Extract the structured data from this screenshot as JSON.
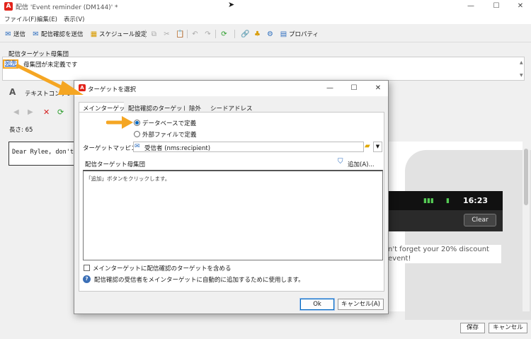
{
  "window": {
    "title": "配信 'Event reminder (DM144)' *",
    "minimize_glyph": "—",
    "maximize_glyph": "☐",
    "close_glyph": "✕"
  },
  "menu": [
    "ファイル(F)",
    "編集(E)",
    "表示(V)"
  ],
  "toolbar": {
    "send": "送信",
    "send_proof": "配信確認を送信",
    "schedule": "スケジュール設定",
    "properties": "プロパティ"
  },
  "main": {
    "target_group_label": "配信ターゲット母集団",
    "to_link": "宛先",
    "undefined_text": "母集団が未定義です",
    "text_content_tab": "テキストコンテンツ",
    "length_label": "長さ: 65",
    "editor_text": "Dear Rylee, don't",
    "save": "保存",
    "cancel": "キャンセル"
  },
  "phone": {
    "time": "16:23",
    "clear": "Clear",
    "sms_text": "n't forget your 20% discount\nevent!"
  },
  "dialog": {
    "title": "ターゲットを選択",
    "tabs": [
      "メインターゲット",
      "配信確認のターゲット",
      "除外",
      "シードアドレス"
    ],
    "radio_db": "データベースで定義",
    "radio_ext": "外部ファイルで定義",
    "mapping_label": "ターゲットマッピング:",
    "mapping_value": "受信者 (nms:recipient)",
    "group_label": "配信ターゲット母集団",
    "add_button": "追加(A)...",
    "group_hint": "「追加」ボタンをクリックします。",
    "include_proof_label": "メインターゲットに配信確認のターゲットを含める",
    "info_text": "配信確認の受信者をメインターゲットに自動的に追加するために使用します。",
    "ok": "Ok",
    "cancel": "キャンセル(A)"
  },
  "colors": {
    "accent": "#0067c0",
    "brand": "#e2231a",
    "callout_arrow": "#f5a623"
  }
}
